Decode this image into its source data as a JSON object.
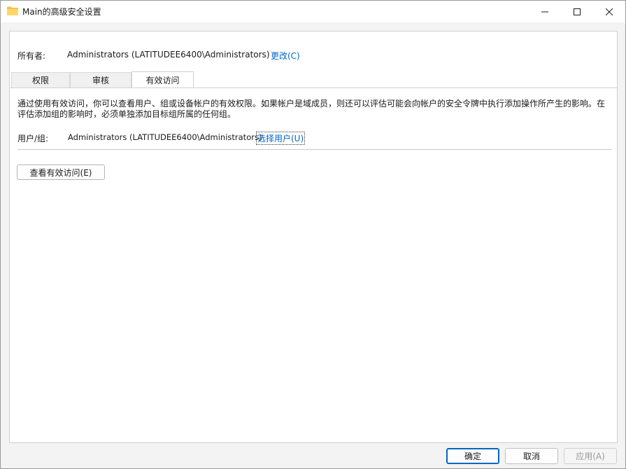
{
  "window": {
    "title": "Main的高级安全设置",
    "icon": "folder-icon",
    "controls": {
      "minimize": "minimize-icon",
      "maximize": "maximize-icon",
      "close": "close-icon"
    }
  },
  "owner": {
    "label": "所有者:",
    "value": "Administrators (LATITUDEE6400\\Administrators)",
    "change_link": "更改(C)"
  },
  "tabs": [
    {
      "label": "权限",
      "active": false
    },
    {
      "label": "审核",
      "active": false
    },
    {
      "label": "有效访问",
      "active": true
    }
  ],
  "effective_access": {
    "description": "通过使用有效访问，你可以查看用户、组或设备帐户的有效权限。如果帐户是域成员，则还可以评估可能会向帐户的安全令牌中执行添加操作所产生的影响。在评估添加组的影响时，必须单独添加目标组所属的任何组。",
    "user_group_label": "用户/组:",
    "user_group_value": "Administrators (LATITUDEE6400\\Administrators)",
    "select_user_link": "选择用户(U)",
    "view_button": "查看有效访问(E)"
  },
  "footer": {
    "ok": "确定",
    "cancel": "取消",
    "apply": "应用(A)"
  },
  "colors": {
    "link": "#0066cc",
    "primary_border": "#0067c0",
    "folder": "#f2c14e"
  }
}
